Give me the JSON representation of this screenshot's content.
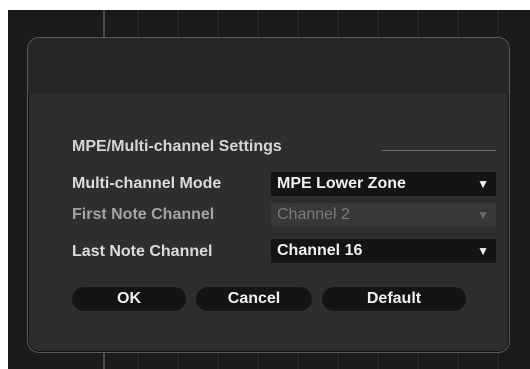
{
  "dialog": {
    "group_title": "MPE/Multi-channel Settings",
    "rows": [
      {
        "label": "Multi-channel Mode",
        "value": "MPE Lower Zone",
        "enabled": true
      },
      {
        "label": "First Note Channel",
        "value": "Channel 2",
        "enabled": false
      },
      {
        "label": "Last Note Channel",
        "value": "Channel 16",
        "enabled": true
      }
    ],
    "buttons": {
      "ok": "OK",
      "cancel": "Cancel",
      "default": "Default"
    }
  },
  "icons": {
    "dropdown": "chevron-down-icon"
  },
  "colors": {
    "dialog_bg": "#2e2e2e",
    "control_bg": "#141414",
    "text": "#dcdcdc",
    "disabled_text": "#7a7a7a"
  }
}
